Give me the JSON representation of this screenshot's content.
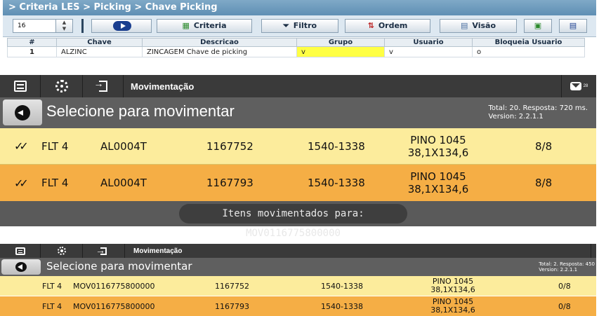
{
  "criteria": {
    "breadcrumb": "> Criteria LES > Picking > Chave Picking",
    "spinner_value": "16",
    "buttons": {
      "criteria": "Criteria",
      "filtro": "Filtro",
      "ordem": "Ordem",
      "visao": "Visão"
    },
    "columns": [
      "#",
      "Chave",
      "Descricao",
      "Grupo",
      "Usuario",
      "Bloqueia Usuario"
    ],
    "rows": [
      {
        "num": "1",
        "chave": "ALZINC",
        "descricao": "ZINCAGEM Chave de picking",
        "grupo": "v",
        "usuario": "v",
        "bloqueia": "o"
      }
    ]
  },
  "app_large": {
    "title": "Movimentação",
    "mail_badge": "28",
    "heading": "Selecione para movimentar",
    "info_line1": "Total: 20. Resposta: 720 ms.",
    "info_line2": "Version: 2.2.1.1",
    "rows": [
      {
        "check": "✓✓",
        "c1": "FLT 4",
        "c2": "AL0004T",
        "c3": "1167752",
        "c4": "1540-1338",
        "c5a": "PINO 1045",
        "c5b": "38,1X134,6",
        "c6": "8/8"
      },
      {
        "check": "✓✓",
        "c1": "FLT 4",
        "c2": "AL0004T",
        "c3": "1167793",
        "c4": "1540-1338",
        "c5a": "PINO 1045",
        "c5b": "38,1X134,6",
        "c6": "8/8"
      }
    ],
    "toast": "Itens movimentados para: MOV0116775800000"
  },
  "app_small": {
    "title": "Movimentação",
    "heading": "Selecione para movimentar",
    "info_line1": "Total: 2. Resposta: 450",
    "info_line2": "Version: 2.2.1.1",
    "rows": [
      {
        "c1": "FLT 4",
        "c2": "MOV0116775800000",
        "c3": "1167752",
        "c4": "1540-1338",
        "c5a": "PINO 1045",
        "c5b": "38,1X134,6",
        "c6": "0/8"
      },
      {
        "c1": "FLT 4",
        "c2": "MOV0116775800000",
        "c3": "1167793",
        "c4": "1540-1338",
        "c5a": "PINO 1045",
        "c5b": "38,1X134,6",
        "c6": "0/8"
      }
    ]
  },
  "colors": {
    "row_light": "#fcec9c",
    "row_orange": "#f5ae45",
    "topbar": "#3a3a3a",
    "headbar": "#5f5f5f"
  }
}
